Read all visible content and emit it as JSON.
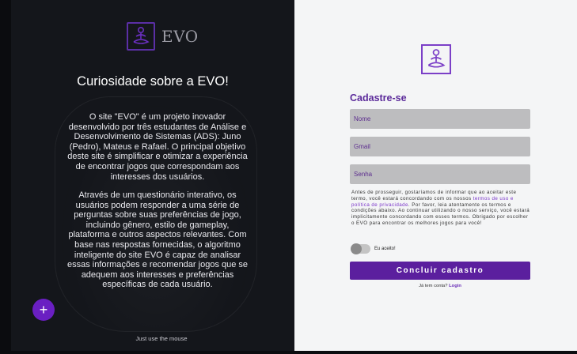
{
  "left": {
    "brand_name": "EVO",
    "title": "Curiosidade sobre a EVO!",
    "paragraph1": "O site \"EVO\" é um projeto inovador desenvolvido por três estudantes de Análise e Desenvolvimento de Sistemas (ADS): Juno (Pedro), Mateus e Rafael. O principal objetivo deste site é simplificar e otimizar a experiência de encontrar jogos que correspondam aos interesses dos usuários.",
    "paragraph2": "Através de um questionário interativo, os usuários podem responder a uma série de perguntas sobre suas preferências de jogo, incluindo gênero, estilo de gameplay, plataforma e outros aspectos relevantes. Com base nas respostas fornecidas, o algoritmo inteligente do site EVO é capaz de analisar essas informações e recomendar jogos que se adequem aos interesses e preferências específicas de cada usuário.",
    "fab_icon": "+",
    "hint": "Just use the mouse"
  },
  "form": {
    "title": "Cadastre-se",
    "name_placeholder": "Nome",
    "email_placeholder": "Gmail",
    "password_placeholder": "Senha",
    "terms_before": "Antes de prosseguir, gostaríamos de informar que ao aceitar este termo, você estará concordando com os nossos ",
    "terms_link": "termos de uso e política de privacidade",
    "terms_after": ". Por favor, leia atentamente os termos e condições abaixo. Ao continuar utilizando o nosso serviço, você estará implicitamente concordando com esses termos. Obrigado por escolher o EVO para encontrar os melhores jogos para você!",
    "accept_label": "Eu aceito!",
    "submit_label": "Concluir cadastro",
    "login_prompt": "Já tem conta? ",
    "login_link": "Login"
  },
  "colors": {
    "accent": "#5b1f9e",
    "left_bg": "#14161b",
    "right_bg": "#f4f5f6"
  },
  "icons": {
    "logo": "meditation-figure-icon",
    "fab": "plus-icon"
  }
}
